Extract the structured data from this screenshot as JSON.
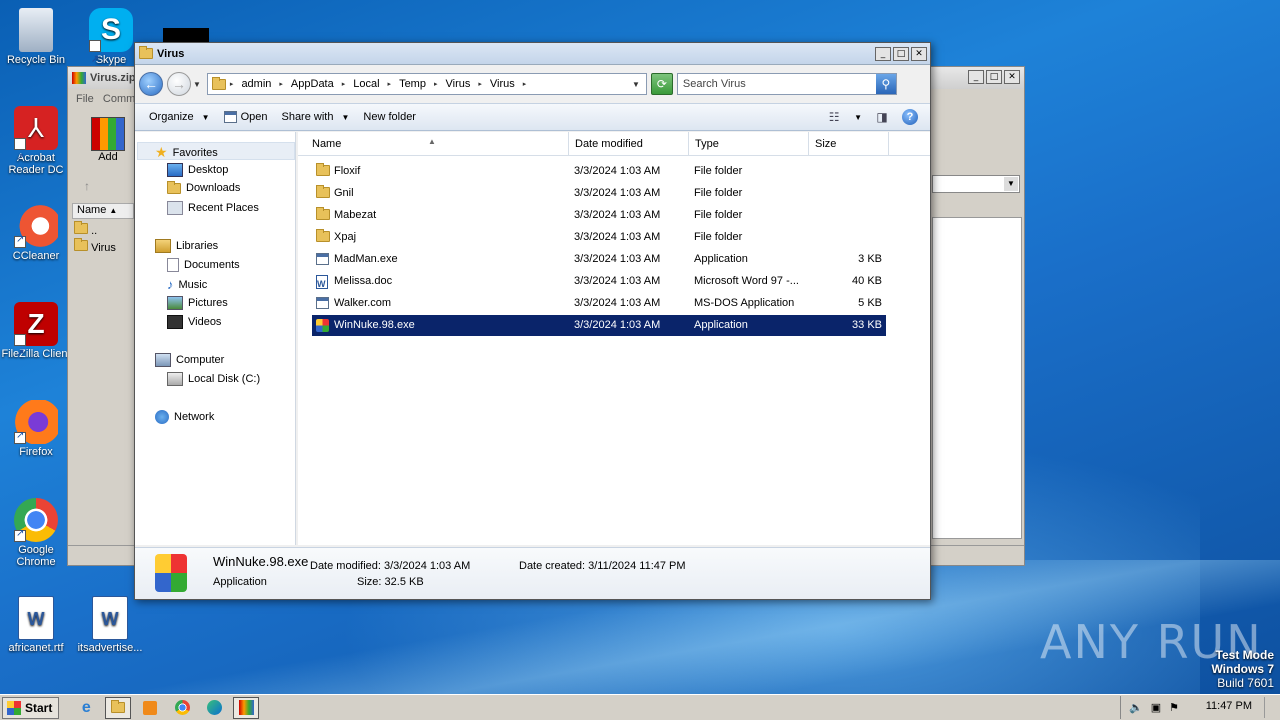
{
  "desktop": {
    "icons": [
      {
        "label": "Recycle Bin"
      },
      {
        "label": "Skype"
      },
      {
        "label": "Acrobat Reader DC"
      },
      {
        "label": "CCleaner"
      },
      {
        "label": "FileZilla Client"
      },
      {
        "label": "Firefox"
      },
      {
        "label": "Google Chrome"
      },
      {
        "label": "africanet.rtf"
      },
      {
        "label": "itsadvertise..."
      }
    ]
  },
  "bg_window": {
    "title": "Virus.zip",
    "menu_file": "File",
    "menu_commands": "Comm",
    "add_label": "Add",
    "name_header": "Name",
    "rows": [
      "..",
      "Virus"
    ]
  },
  "explorer": {
    "title": "Virus",
    "breadcrumbs": [
      "admin",
      "AppData",
      "Local",
      "Temp",
      "Virus",
      "Virus"
    ],
    "search_placeholder": "Search Virus",
    "toolbar": {
      "organize": "Organize",
      "open": "Open",
      "share_with": "Share with",
      "new_folder": "New folder"
    },
    "nav": {
      "favorites": "Favorites",
      "desktop": "Desktop",
      "downloads": "Downloads",
      "recent_places": "Recent Places",
      "libraries": "Libraries",
      "documents": "Documents",
      "music": "Music",
      "pictures": "Pictures",
      "videos": "Videos",
      "computer": "Computer",
      "local_disk": "Local Disk (C:)",
      "network": "Network"
    },
    "columns": {
      "name": "Name",
      "date": "Date modified",
      "type": "Type",
      "size": "Size"
    },
    "files": [
      {
        "name": "Floxif",
        "date": "3/3/2024 1:03 AM",
        "type": "File folder",
        "size": "",
        "icon": "folder-icon"
      },
      {
        "name": "Gnil",
        "date": "3/3/2024 1:03 AM",
        "type": "File folder",
        "size": "",
        "icon": "folder-icon"
      },
      {
        "name": "Mabezat",
        "date": "3/3/2024 1:03 AM",
        "type": "File folder",
        "size": "",
        "icon": "folder-icon"
      },
      {
        "name": "Xpaj",
        "date": "3/3/2024 1:03 AM",
        "type": "File folder",
        "size": "",
        "icon": "folder-icon"
      },
      {
        "name": "MadMan.exe",
        "date": "3/3/2024 1:03 AM",
        "type": "Application",
        "size": "3 KB",
        "icon": "application-icon"
      },
      {
        "name": "Melissa.doc",
        "date": "3/3/2024 1:03 AM",
        "type": "Microsoft Word 97 -...",
        "size": "40 KB",
        "icon": "word-document-icon"
      },
      {
        "name": "Walker.com",
        "date": "3/3/2024 1:03 AM",
        "type": "MS-DOS Application",
        "size": "5 KB",
        "icon": "application-icon"
      },
      {
        "name": "WinNuke.98.exe",
        "date": "3/3/2024 1:03 AM",
        "type": "Application",
        "size": "33 KB",
        "icon": "winnuke-icon",
        "selected": true
      }
    ],
    "details": {
      "file_name": "WinNuke.98.exe",
      "file_type": "Application",
      "date_modified_label": "Date modified:",
      "date_modified": "3/3/2024 1:03 AM",
      "size_label": "Size:",
      "size": "32.5 KB",
      "date_created_label": "Date created:",
      "date_created": "3/11/2024 11:47 PM"
    }
  },
  "watermark": "ANY RUN",
  "test_mode": {
    "line1": "Test Mode",
    "line2": "Windows 7",
    "line3": "Build 7601"
  },
  "taskbar": {
    "start_label": "Start",
    "clock": "11:47 PM"
  }
}
